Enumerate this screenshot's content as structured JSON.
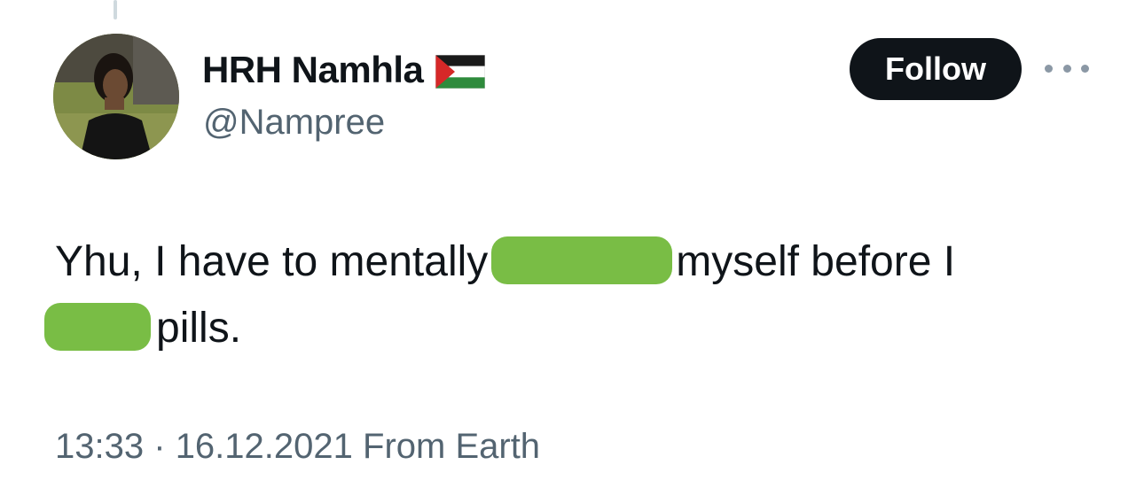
{
  "author": {
    "display_name": "HRH Namhla",
    "flag_emoji": "palestine-flag",
    "handle": "@Nampree"
  },
  "actions": {
    "follow_label": "Follow"
  },
  "tweet": {
    "text_part1": "Yhu, I have to mentally",
    "text_part2": "myself before I",
    "text_part3": "pills."
  },
  "meta": {
    "time": "13:33",
    "separator": "·",
    "date": "16.12.2021",
    "source": "From Earth"
  },
  "colors": {
    "redaction": "#79bd45",
    "follow_bg": "#0f1419",
    "secondary_text": "#536471"
  }
}
